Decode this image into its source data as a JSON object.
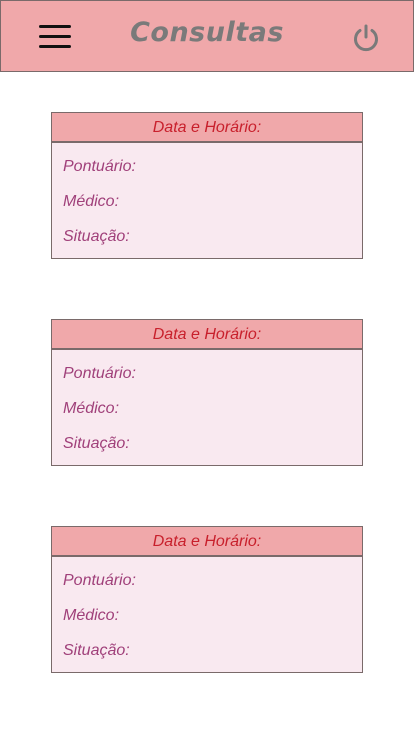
{
  "header": {
    "title": "Consultas",
    "menu_icon": "hamburger-menu-icon",
    "power_icon": "power-icon",
    "background_color": "#f0a8aa",
    "title_color": "#7a7a7a"
  },
  "cards": [
    {
      "heading": "Data e Horário:",
      "fields": [
        "Pontuário:",
        "Médico:",
        "Situação:"
      ]
    },
    {
      "heading": "Data e Horário:",
      "fields": [
        "Pontuário:",
        "Médico:",
        "Situação:"
      ]
    },
    {
      "heading": "Data e Horário:",
      "fields": [
        "Pontuário:",
        "Médico:",
        "Situação:"
      ]
    }
  ],
  "colors": {
    "card_header_bg": "#f0a8aa",
    "card_body_bg": "#f9e9f0",
    "heading_text": "#c8202c",
    "field_text": "#a0407a"
  }
}
